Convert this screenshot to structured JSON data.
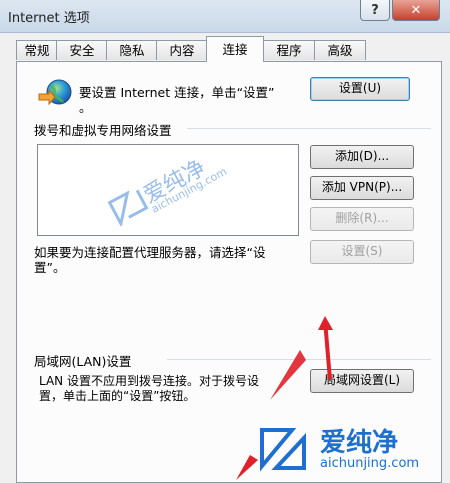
{
  "window": {
    "title": "Internet 选项",
    "help_label": "?",
    "close_label": "✕"
  },
  "tabs": [
    {
      "label": "常规"
    },
    {
      "label": "安全"
    },
    {
      "label": "隐私"
    },
    {
      "label": "内容"
    },
    {
      "label": "连接",
      "active": true
    },
    {
      "label": "程序"
    },
    {
      "label": "高级"
    }
  ],
  "setup": {
    "text_line1": "要设置 Internet 连接，单击“设置”",
    "text_line2": "。",
    "button": "设置(U)"
  },
  "dialup": {
    "heading": "拨号和虚拟专用网络设置",
    "add_button": "添加(D)...",
    "add_vpn_button": "添加 VPN(P)...",
    "delete_button": "删除(R)...",
    "proxy_text_line1": "如果要为连接配置代理服务器，请选择“设",
    "proxy_text_line2": "置”。",
    "settings_button": "设置(S)"
  },
  "lan": {
    "heading": "局域网(LAN)设置",
    "desc_line1": "LAN 设置不应用到拨号连接。对于拨号设",
    "desc_line2": "置，单击上面的“设置”按钮。",
    "button": "局域网设置(L)"
  },
  "watermark": {
    "brand": "爱纯净",
    "url": "aichunjing.com"
  },
  "colors": {
    "accent": "#3c7fb1",
    "watermark_blue": "#1f6fd1",
    "arrow_red": "#e0202a"
  }
}
